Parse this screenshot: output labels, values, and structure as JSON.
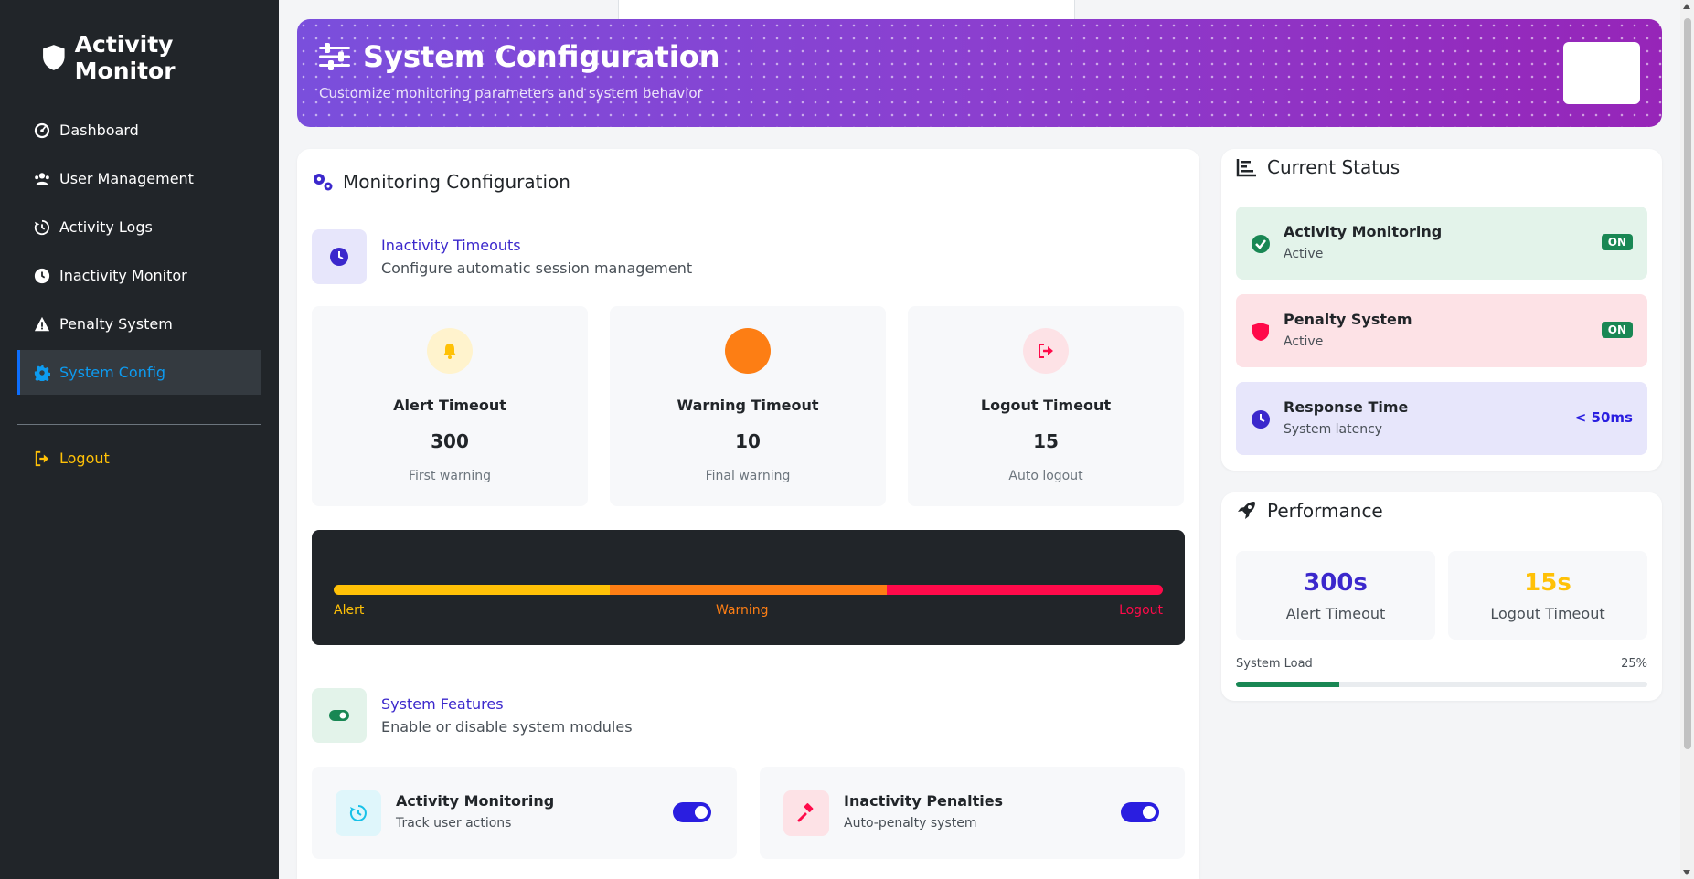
{
  "sidebar": {
    "brand": "Activity Monitor",
    "items": [
      {
        "label": "Dashboard",
        "icon": "gauge-icon"
      },
      {
        "label": "User Management",
        "icon": "users-icon"
      },
      {
        "label": "Activity Logs",
        "icon": "history-icon"
      },
      {
        "label": "Inactivity Monitor",
        "icon": "clock-icon"
      },
      {
        "label": "Penalty System",
        "icon": "warning-icon"
      },
      {
        "label": "System Config",
        "icon": "cog-icon",
        "active": true
      }
    ],
    "logout": "Logout"
  },
  "header": {
    "title": "System Configuration",
    "subtitle": "Customize monitoring parameters and system behavior"
  },
  "config": {
    "title": "Monitoring Configuration",
    "timeouts": {
      "title": "Inactivity Timeouts",
      "description": "Configure automatic session management",
      "items": [
        {
          "label": "Alert Timeout",
          "value": "300",
          "desc": "First warning"
        },
        {
          "label": "Warning Timeout",
          "value": "10",
          "desc": "Final warning"
        },
        {
          "label": "Logout Timeout",
          "value": "15",
          "desc": "Auto logout"
        }
      ]
    },
    "timeline": {
      "alert": "Alert",
      "warning": "Warning",
      "logout": "Logout"
    },
    "features": {
      "title": "System Features",
      "description": "Enable or disable system modules",
      "items": [
        {
          "name": "Activity Monitoring",
          "desc": "Track user actions",
          "enabled": true
        },
        {
          "name": "Inactivity Penalties",
          "desc": "Auto-penalty system",
          "enabled": true
        }
      ]
    }
  },
  "status": {
    "title": "Current Status",
    "items": [
      {
        "name": "Activity Monitoring",
        "sub": "Active",
        "badge": "ON"
      },
      {
        "name": "Penalty System",
        "sub": "Active",
        "badge": "ON"
      },
      {
        "name": "Response Time",
        "sub": "System latency",
        "value": "< 50ms"
      }
    ]
  },
  "performance": {
    "title": "Performance",
    "alert_value": "300s",
    "alert_label": "Alert Timeout",
    "logout_value": "15s",
    "logout_label": "Logout Timeout",
    "load_label": "System Load",
    "load_pct": "25%",
    "load_fraction": 0.25
  },
  "colors": {
    "accent": "#2a1ee0",
    "alert": "#ffc107",
    "warning": "#fd7e14",
    "danger": "#ff0a4a",
    "success": "#198754"
  }
}
